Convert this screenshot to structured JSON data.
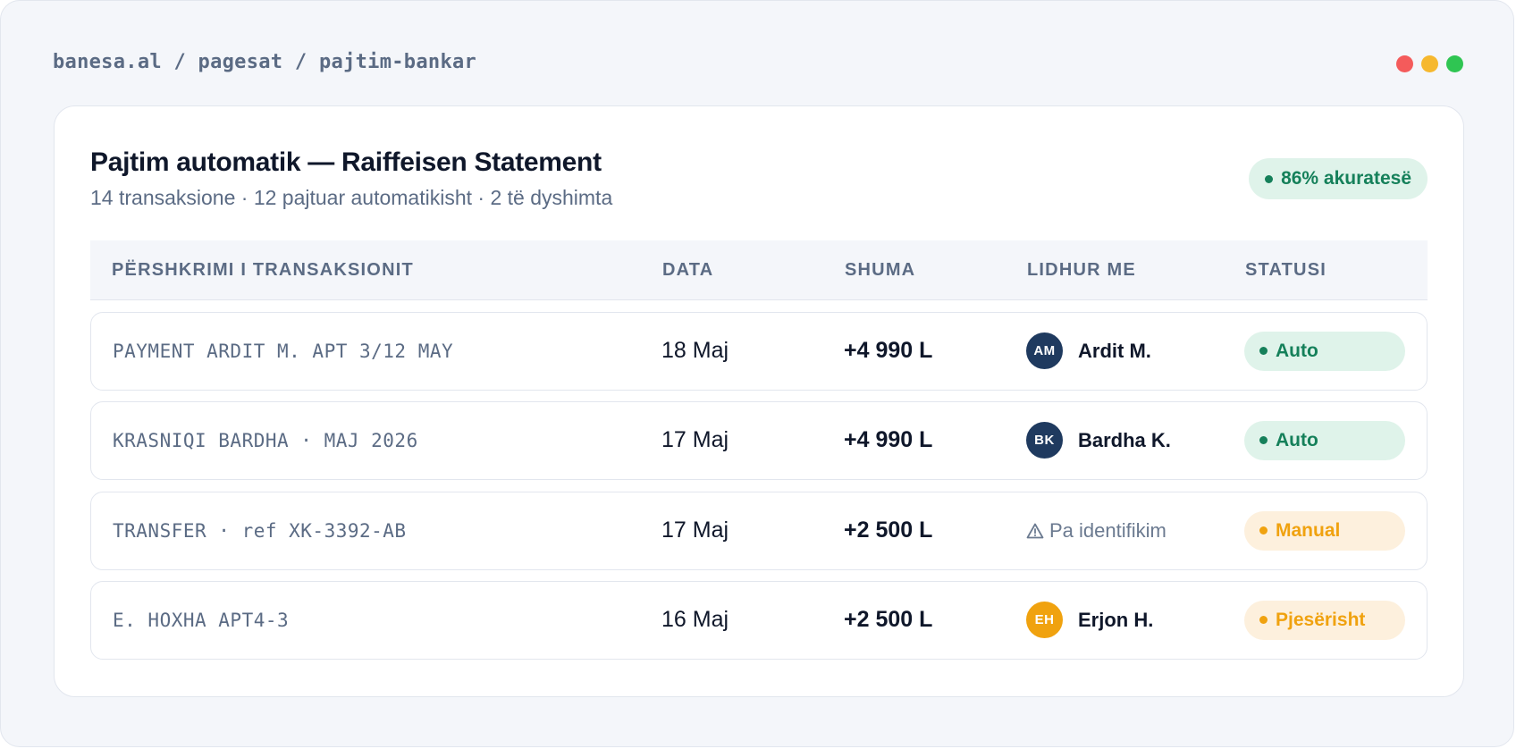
{
  "window": {
    "breadcrumb": "banesa.al / pagesat / pajtim-bankar",
    "controls": [
      {
        "name": "close",
        "color": "#f45b5b"
      },
      {
        "name": "minimize",
        "color": "#f6b82e"
      },
      {
        "name": "maximize",
        "color": "#2fc552"
      }
    ]
  },
  "card": {
    "title": "Pajtim automatik — Raiffeisen Statement",
    "subtitle": "14 transaksione · 12 pajtuar automatikisht · 2 të dyshimta",
    "accuracy_badge": "86% akuratesë"
  },
  "table": {
    "headers": {
      "description": "PËRSHKRIMI I TRANSAKSIONIT",
      "date": "DATA",
      "amount": "SHUMA",
      "linked": "LIDHUR ME",
      "status": "STATUSI"
    },
    "rows": [
      {
        "description": "PAYMENT ARDIT M. APT 3/12 MAY",
        "date": "18 Maj",
        "amount": "+4 990 L",
        "linked": {
          "initials": "AM",
          "name": "Ardit M.",
          "avatar_color": "#1f3a5f"
        },
        "status": {
          "label": "Auto",
          "kind": "auto"
        }
      },
      {
        "description": "KRASNIQI BARDHA · MAJ 2026",
        "date": "17 Maj",
        "amount": "+4 990 L",
        "linked": {
          "initials": "BK",
          "name": "Bardha K.",
          "avatar_color": "#1f3a5f"
        },
        "status": {
          "label": "Auto",
          "kind": "auto"
        }
      },
      {
        "description": "TRANSFER · ref XK-3392-AB",
        "date": "17 Maj",
        "amount": "+2 500 L",
        "linked": {
          "unidentified": "Pa identifikim",
          "icon": "warning-icon"
        },
        "status": {
          "label": "Manual",
          "kind": "manual"
        }
      },
      {
        "description": "E. HOXHA APT4-3",
        "date": "16 Maj",
        "amount": "+2 500 L",
        "linked": {
          "initials": "EH",
          "name": "Erjon H.",
          "avatar_color": "#f0a20f"
        },
        "status": {
          "label": "Pjesërisht",
          "kind": "partial"
        }
      }
    ]
  },
  "colors": {
    "auto_bg": "#dff3ea",
    "auto_fg": "#15805a",
    "manual_bg": "#fdf0dd",
    "manual_fg": "#f0a20f"
  }
}
